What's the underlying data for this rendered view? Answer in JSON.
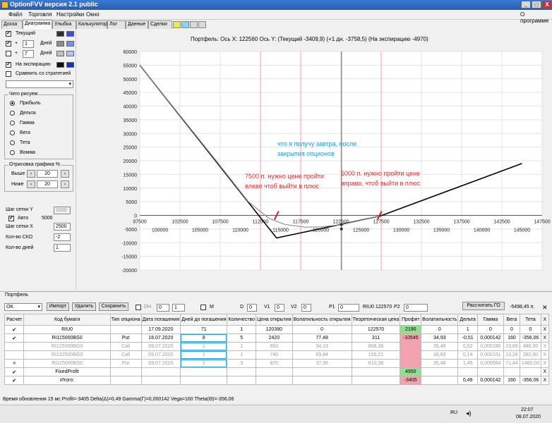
{
  "window": {
    "title": "OptionFVV версия 2.1 public",
    "btn_min": "_",
    "btn_max": "□",
    "btn_close": "X"
  },
  "menu": {
    "items": [
      "Файл",
      "Торговля",
      "Настройки",
      "Окно"
    ],
    "about": "О программе"
  },
  "tabs": [
    "Доска",
    "Диаграмма",
    "Улыбка",
    "Калькулятор",
    "Лог",
    "Данные",
    "Сделки"
  ],
  "left": {
    "current_label": "Текущий",
    "plus": "+",
    "days1_value": "1",
    "days2_value": "7",
    "days_label": "Дней",
    "expiry_label": "На экспирацию",
    "compare_label": "Сравнить со стратегией",
    "what_group": "Чего рисуем",
    "draw_options": [
      "Прибыль",
      "Дельта",
      "Гамма",
      "Вега",
      "Тета",
      "Вомма"
    ],
    "render_group": "Отрисовка графика %",
    "above_label": "Выше",
    "above_value": "20",
    "below_label": "Ниже",
    "below_value": "20",
    "step_y_label": "Шаг сетки Y",
    "step_y_value": "1000",
    "auto_label": "Авто",
    "auto_value": "5000",
    "step_x_label": "Шаг сетки X",
    "step_x_value": "2500",
    "cnt_std_label": "Кол-во СКО",
    "cnt_std_value": "-2",
    "cnt_days_label": "Кол-во дней",
    "cnt_days_value": "1"
  },
  "chart_title": "Портфель: Ось X: 122560 Ось Y:  (Текущий -3409,9)  (+1 дн. -3758,5)  (На экспирацию -4970)",
  "annotations": {
    "tomorrow": "что я получу завтра, после закрытия опционов",
    "left": "7500 п. нужно цене пройти влево чтоб выйти в плюс",
    "right": "5000 п. нужно пройти цене вправо, чтоб выйти в плюс"
  },
  "chart_data": {
    "type": "line",
    "title": "",
    "xlabel": "",
    "ylabel": "",
    "xlim": [
      97500,
      147500
    ],
    "ylim": [
      -20000,
      60000
    ],
    "xticks_top": [
      97500,
      102500,
      107500,
      112500,
      117500,
      122500,
      127500,
      132500,
      137500,
      142500,
      147500
    ],
    "xticks_bottom": [
      100000,
      105000,
      110000,
      115000,
      120000,
      125000,
      130000,
      135000,
      140000,
      145000
    ],
    "yticks": [
      60000,
      55000,
      50000,
      45000,
      40000,
      35000,
      30000,
      25000,
      20000,
      15000,
      10000,
      5000,
      0,
      -5000,
      -10000,
      -15000,
      -20000
    ],
    "cursor_x": 122560,
    "series": [
      {
        "color": "#000000",
        "x": [
          97500,
          114500,
          127300,
          145000
        ],
        "y": [
          55000,
          -8250,
          -320,
          19000
        ]
      },
      {
        "color": "#909090",
        "x": [
          97500,
          107000,
          111000,
          113500,
          115500,
          118000,
          120000,
          122560,
          125000,
          127300
        ],
        "y": [
          55000,
          20000,
          5000,
          -1000,
          -3300,
          -4300,
          -4200,
          -3400,
          -1800,
          -320
        ]
      }
    ],
    "markers": [
      {
        "x": 114500,
        "y": 0,
        "color": "#e02020"
      },
      {
        "x": 127300,
        "y": 0,
        "color": "#e02020"
      }
    ]
  },
  "portfolio": {
    "group_label": "Портфель",
    "select_value": "OK",
    "import_label": "Импорт",
    "delete_label": "Удалить",
    "save_label": "Сохранить",
    "dh_label": "DH",
    "stepper1": "0",
    "stepper2": "1",
    "m_label": "M",
    "d_label": "D",
    "d_value": "0",
    "v1_label": "V1",
    "v1_value": "0",
    "v2_label": "V2",
    "v2_value": "0",
    "p1_label": "P1",
    "p1_value": "0",
    "riu_label": "RIU0 122570",
    "p2_label": "P2",
    "p2_value": "0",
    "calc_go_label": "Рассчитать ГО",
    "go_value": "-5498,45 п."
  },
  "table": {
    "headers": [
      "Расчет",
      "Код бумаги",
      "Тип опциона",
      "Дата погашения",
      "Дней до погашения",
      "Количество",
      "Цена открытия",
      "Волатильность открытия",
      "Теоретическая цена",
      "Профит",
      "Волатильность",
      "Дельта",
      "Гамма",
      "Вега",
      "Тета",
      "X"
    ],
    "rows": [
      {
        "check": "✔",
        "cells": [
          "RIU0",
          "",
          "17.09.2020",
          "71",
          "1",
          "120380",
          "0",
          "122570",
          "2190",
          "0",
          "1",
          "0",
          "0",
          "0",
          "X"
        ],
        "dim": false,
        "profit": "green"
      },
      {
        "check": "✔",
        "cells": [
          "RI115000BS0",
          "Put",
          "16.07.2020",
          "8",
          "5",
          "2420",
          "77,48",
          "311",
          "-10545",
          "34,93",
          "-0,51",
          "0,000142",
          "160",
          "-356,06",
          "X"
        ],
        "dim": false,
        "profit": "pink"
      },
      {
        "check": "",
        "cells": [
          "RI125000BG0",
          "Call",
          "09.07.2020",
          "1",
          "1",
          "950",
          "34,19",
          "808,36",
          "",
          "35,46",
          "0,52",
          "0,000180",
          "23,69",
          "486,00",
          "X"
        ],
        "dim": true,
        "profit": "pink"
      },
      {
        "check": "",
        "cells": [
          "RI122500BG0",
          "Call",
          "09.07.2020",
          "1",
          "1",
          "740",
          "69,84",
          "155,21",
          "",
          "36,83",
          "0,14",
          "0,000101",
          "13,26",
          "282,00",
          "X"
        ],
        "dim": true,
        "profit": "pink"
      },
      {
        "check": "■",
        "cells": [
          "RI125000BS0",
          "Put",
          "09.07.2020",
          "1",
          "3",
          "870",
          "37,96",
          "810,36",
          "",
          "35,46",
          "1,45",
          "0,000564",
          "71,44",
          "1460,00",
          "X"
        ],
        "dim": true,
        "profit": "pink"
      },
      {
        "check": "✔",
        "cells": [
          "FixedProfit",
          "",
          "",
          "",
          "",
          "",
          "",
          "",
          "4950",
          "",
          "",
          "",
          "",
          "",
          "X"
        ],
        "dim": false,
        "profit": "green"
      },
      {
        "check": "✔",
        "cells": [
          "Итого:",
          "",
          "",
          "",
          "",
          "",
          "",
          "",
          "-3405",
          "",
          "0,49",
          "0,000142",
          "160",
          "-356,06",
          "X"
        ],
        "dim": false,
        "profit": "pink"
      }
    ]
  },
  "status": "Время обновления 15 мс  Profit=-3405 Delta(Δ)=0,49 Gamma(Γ)=0,000142 Vega=160 Theta(Θ)=-356,06",
  "taskbar": {
    "lang": "RU",
    "time": "22:07",
    "date": "08.07.2020"
  }
}
